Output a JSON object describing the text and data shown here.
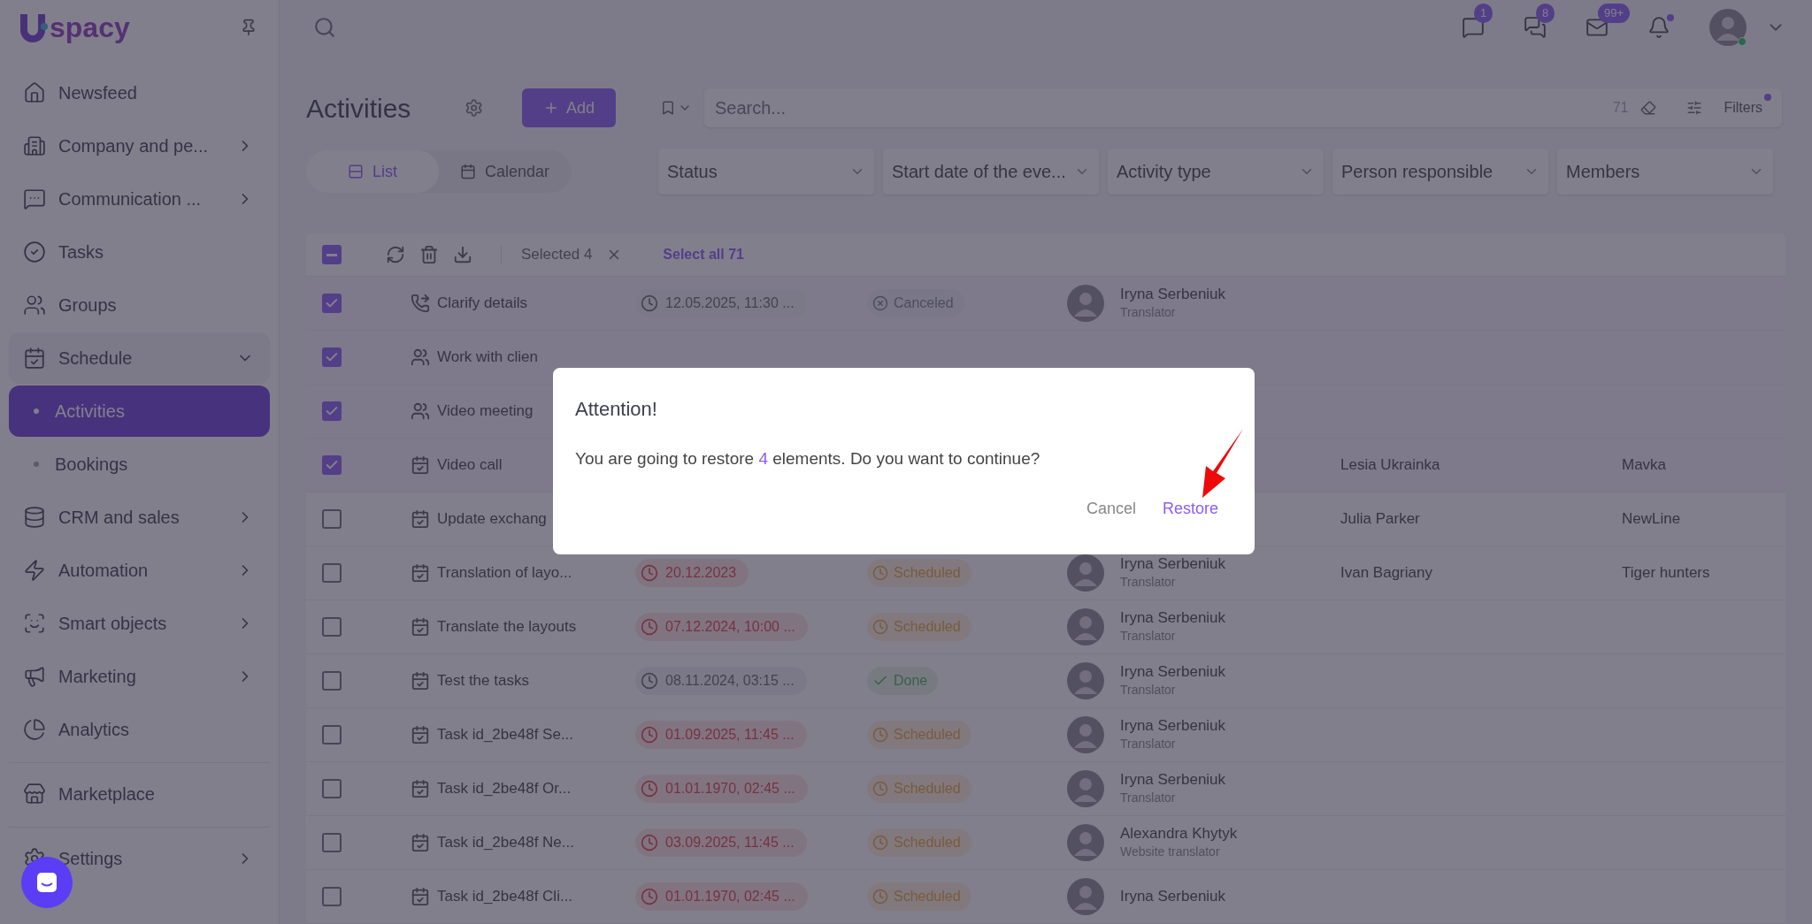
{
  "sidebar": {
    "logo": "spacy",
    "items": [
      {
        "label": "Newsfeed",
        "kind": "item",
        "selected": false
      },
      {
        "label": "Company and pe...",
        "kind": "item",
        "expanded": false,
        "selected": false
      },
      {
        "label": "Communication ...",
        "kind": "item",
        "expanded": false,
        "selected": false
      },
      {
        "label": "Tasks",
        "kind": "item",
        "selected": false
      },
      {
        "label": "Groups",
        "kind": "item",
        "selected": false
      },
      {
        "label": "Schedule",
        "kind": "item",
        "expanded": true,
        "selected": false
      },
      {
        "label": "Activities",
        "kind": "subitem",
        "selected": true
      },
      {
        "label": "Bookings",
        "kind": "subitem",
        "selected": false
      },
      {
        "label": "CRM and sales",
        "kind": "item",
        "expanded": false,
        "selected": false
      },
      {
        "label": "Automation",
        "kind": "item",
        "expanded": false,
        "selected": false
      },
      {
        "label": "Smart objects",
        "kind": "item",
        "expanded": false,
        "selected": false
      },
      {
        "label": "Marketing",
        "kind": "item",
        "expanded": false,
        "selected": false
      },
      {
        "label": "Analytics",
        "kind": "item",
        "selected": false
      },
      {
        "label": "Marketplace",
        "kind": "item",
        "selected": false
      },
      {
        "label": "Settings",
        "kind": "item",
        "expanded": false,
        "selected": false
      }
    ]
  },
  "header": {
    "notifications": [
      {
        "badge": "1"
      },
      {
        "badge": "8"
      },
      {
        "badge": "99+"
      },
      {
        "unread": true
      }
    ]
  },
  "toolbar": {
    "title": "Activities",
    "add_button": "Add",
    "search": {
      "placeholder": "Search..."
    },
    "count": "71",
    "filters_button": "Filters",
    "filters_active": true,
    "views": [
      {
        "label": "List",
        "selected": true
      },
      {
        "label": "Calendar",
        "selected": false
      }
    ],
    "filters": [
      "Status",
      "Start date of the eve...",
      "Activity type",
      "Person responsible",
      "Members"
    ]
  },
  "bulk_bar": {
    "checked": true,
    "selected_label": "Selected 4",
    "select_all": "Select all 71"
  },
  "rows": [
    {
      "checked": true,
      "kind": "call",
      "title": "Clarify details",
      "date": {
        "text": "12.05.2025, 11:30 ...",
        "overdue": false
      },
      "status": {
        "text": "Canceled",
        "kind": "canceled"
      },
      "person": {
        "name": "Iryna Serbeniuk",
        "role": "Translator"
      }
    },
    {
      "checked": true,
      "kind": "meeting",
      "title": "Work with clien"
    },
    {
      "checked": true,
      "kind": "meeting",
      "title": "Video meeting"
    },
    {
      "checked": true,
      "kind": "task",
      "title": "Video call",
      "responsible": "Lesia Ukrainka",
      "members": "Mavka"
    },
    {
      "checked": false,
      "kind": "task",
      "title": "Update exchang",
      "responsible": "Julia Parker",
      "members": "NewLine"
    },
    {
      "checked": false,
      "kind": "task",
      "title": "Translation of layo...",
      "date": {
        "text": "20.12.2023",
        "overdue": true
      },
      "status": {
        "text": "Scheduled",
        "kind": "scheduled"
      },
      "person": {
        "name": "Iryna Serbeniuk",
        "role": "Translator"
      },
      "responsible": "Ivan Bagriany",
      "members": "Tiger hunters"
    },
    {
      "checked": false,
      "kind": "task",
      "title": "Translate the layouts",
      "date": {
        "text": "07.12.2024, 10:00 ...",
        "overdue": true
      },
      "status": {
        "text": "Scheduled",
        "kind": "scheduled"
      },
      "person": {
        "name": "Iryna Serbeniuk",
        "role": "Translator"
      }
    },
    {
      "checked": false,
      "kind": "task",
      "title": "Test the tasks",
      "date": {
        "text": "08.11.2024, 03:15 ...",
        "overdue": false
      },
      "status": {
        "text": "Done",
        "kind": "done"
      },
      "person": {
        "name": "Iryna Serbeniuk",
        "role": "Translator"
      }
    },
    {
      "checked": false,
      "kind": "task",
      "title": "Task id_2be48f Se...",
      "date": {
        "text": "01.09.2025, 11:45 ...",
        "overdue": true
      },
      "status": {
        "text": "Scheduled",
        "kind": "scheduled"
      },
      "person": {
        "name": "Iryna Serbeniuk",
        "role": "Translator"
      }
    },
    {
      "checked": false,
      "kind": "task",
      "title": "Task id_2be48f Or...",
      "date": {
        "text": "01.01.1970, 02:45 ...",
        "overdue": true
      },
      "status": {
        "text": "Scheduled",
        "kind": "scheduled"
      },
      "person": {
        "name": "Iryna Serbeniuk",
        "role": "Translator"
      }
    },
    {
      "checked": false,
      "kind": "task",
      "title": "Task id_2be48f Ne...",
      "date": {
        "text": "03.09.2025, 11:45 ...",
        "overdue": true
      },
      "status": {
        "text": "Scheduled",
        "kind": "scheduled"
      },
      "person": {
        "name": "Alexandra Khytyk",
        "role": "Website translator"
      }
    },
    {
      "checked": false,
      "kind": "task",
      "title": "Task id_2be48f Cli...",
      "date": {
        "text": "01.01.1970, 02:45 ...",
        "overdue": true
      },
      "status": {
        "text": "Scheduled",
        "kind": "scheduled"
      },
      "person": {
        "name": "Iryna Serbeniuk"
      }
    }
  ],
  "dialog": {
    "title": "Attention!",
    "message_before": "You are going to restore",
    "count": "4",
    "message_after": "elements. Do you want to continue?",
    "cancel": "Cancel",
    "confirm": "Restore"
  }
}
